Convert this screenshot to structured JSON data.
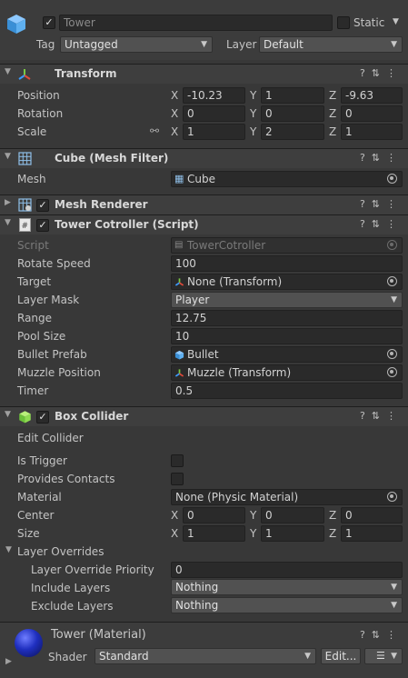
{
  "gameobject": {
    "name": "Tower",
    "active": true,
    "static_label": "Static",
    "tag_label": "Tag",
    "tag_value": "Untagged",
    "layer_label": "Layer",
    "layer_value": "Default"
  },
  "transform": {
    "title": "Transform",
    "position_label": "Position",
    "rotation_label": "Rotation",
    "scale_label": "Scale",
    "axis_x": "X",
    "axis_y": "Y",
    "axis_z": "Z",
    "position": [
      "-10.23",
      "1",
      "-9.63"
    ],
    "rotation": [
      "0",
      "0",
      "0"
    ],
    "scale": [
      "1",
      "2",
      "1"
    ]
  },
  "mesh_filter": {
    "title": "Cube (Mesh Filter)",
    "mesh_label": "Mesh",
    "mesh_value": "Cube"
  },
  "mesh_renderer": {
    "title": "Mesh Renderer",
    "enabled": true
  },
  "tower_controller": {
    "title": "Tower Cotroller (Script)",
    "enabled": true,
    "script_label": "Script",
    "script_value": "TowerCotroller",
    "rotate_speed_label": "Rotate Speed",
    "rotate_speed": "100",
    "target_label": "Target",
    "target": "None (Transform)",
    "layer_mask_label": "Layer Mask",
    "layer_mask": "Player",
    "range_label": "Range",
    "range": "12.75",
    "pool_size_label": "Pool Size",
    "pool_size": "10",
    "bullet_prefab_label": "Bullet Prefab",
    "bullet_prefab": "Bullet",
    "muzzle_label": "Muzzle Position",
    "muzzle": "Muzzle (Transform)",
    "timer_label": "Timer",
    "timer": "0.5"
  },
  "box_collider": {
    "title": "Box Collider",
    "enabled": true,
    "edit_collider": "Edit Collider",
    "is_trigger_label": "Is Trigger",
    "provides_contacts_label": "Provides Contacts",
    "material_label": "Material",
    "material": "None (Physic Material)",
    "center_label": "Center",
    "center": [
      "0",
      "0",
      "0"
    ],
    "size_label": "Size",
    "size": [
      "1",
      "1",
      "1"
    ],
    "layer_overrides_label": "Layer Overrides",
    "priority_label": "Layer Override Priority",
    "priority": "0",
    "include_label": "Include Layers",
    "include": "Nothing",
    "exclude_label": "Exclude Layers",
    "exclude": "Nothing"
  },
  "material": {
    "title": "Tower (Material)",
    "shader_label": "Shader",
    "shader": "Standard",
    "edit_button": "Edit..."
  },
  "icons": [
    "cube-icon",
    "transform-icon",
    "grid-icon",
    "mesh-renderer-icon",
    "script-icon",
    "box-collider-icon",
    "help-icon",
    "settings-icon",
    "more-icon",
    "object-picker-icon",
    "sphere-material-icon"
  ],
  "colors": {
    "background": "#383838",
    "header": "#3e3e3e",
    "field": "#2a2a2a",
    "dropdown": "#515151",
    "material_sphere": "#1f2fbf"
  }
}
